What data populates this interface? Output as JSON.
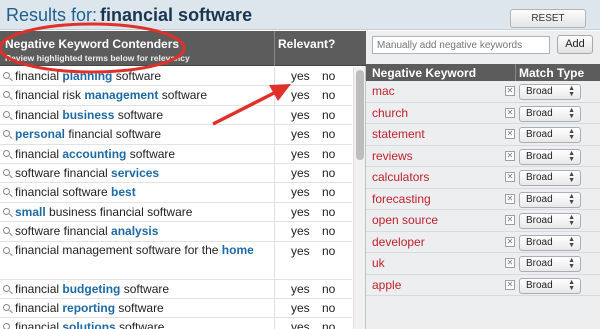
{
  "header": {
    "results_label": "Results for:",
    "query": "financial software",
    "reset_label": "RESET"
  },
  "left_panel": {
    "col_keyword": "Negative Keyword Contenders",
    "col_keyword_sub": "Review highlighted terms below for relevancy",
    "col_relevant": "Relevant?",
    "yes_label": "yes",
    "no_label": "no",
    "rows": [
      {
        "parts": [
          "financial ",
          "planning",
          " software"
        ]
      },
      {
        "parts": [
          "financial risk ",
          "management",
          " software"
        ]
      },
      {
        "parts": [
          "financial ",
          "business",
          " software"
        ]
      },
      {
        "parts": [
          "",
          "personal",
          " financial software"
        ]
      },
      {
        "parts": [
          "financial ",
          "accounting",
          " software"
        ]
      },
      {
        "parts": [
          "software financial ",
          "services",
          ""
        ]
      },
      {
        "parts": [
          "financial software ",
          "best",
          ""
        ]
      },
      {
        "parts": [
          "",
          "small",
          " business financial software"
        ]
      },
      {
        "parts": [
          "software financial ",
          "analysis",
          ""
        ]
      },
      {
        "parts": [
          "financial management software for the ",
          "home",
          ""
        ]
      },
      {
        "parts": [
          "financial ",
          "budgeting",
          " software"
        ]
      },
      {
        "parts": [
          "financial ",
          "reporting",
          " software"
        ]
      },
      {
        "parts": [
          "financial ",
          "solutions",
          " software"
        ]
      }
    ]
  },
  "right_panel": {
    "add_placeholder": "Manually add negative keywords",
    "add_label": "Add",
    "col_negative": "Negative Keyword",
    "col_match": "Match Type",
    "remove_glyph": "✕",
    "negatives": [
      {
        "keyword": "mac",
        "match": "Broad"
      },
      {
        "keyword": "church",
        "match": "Broad"
      },
      {
        "keyword": "statement",
        "match": "Broad"
      },
      {
        "keyword": "reviews",
        "match": "Broad"
      },
      {
        "keyword": "calculators",
        "match": "Broad"
      },
      {
        "keyword": "forecasting",
        "match": "Broad"
      },
      {
        "keyword": "open source",
        "match": "Broad"
      },
      {
        "keyword": "developer",
        "match": "Broad"
      },
      {
        "keyword": "uk",
        "match": "Broad"
      },
      {
        "keyword": "apple",
        "match": "Broad"
      }
    ]
  },
  "colors": {
    "highlight_term": "#1e6aa6",
    "negative_keyword": "#c0212d",
    "annotation_red": "#e0302a",
    "header_bar": "#5c5c5c"
  }
}
